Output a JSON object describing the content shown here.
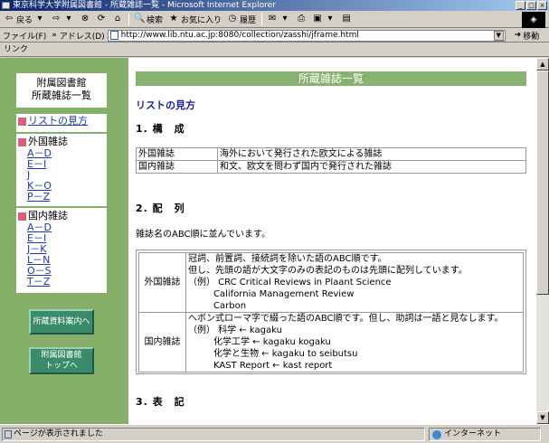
{
  "window": {
    "title": "東京科学大学附属図書館 - 所蔵雑誌一覧 - Microsoft Internet Explorer",
    "buttons": [
      "_",
      "□",
      "×"
    ]
  },
  "toolbar": {
    "back": "戻る",
    "search": "検索",
    "favorites": "お気に入り",
    "history": "履歴"
  },
  "address": {
    "menu_file": "ファイル(F)",
    "chevron": "»",
    "label": "アドレス(D)",
    "url": "http://www.lib.ntu.ac.jp:8080/collection/zasshi/jframe.html",
    "go": "移動"
  },
  "linkbar": {
    "label": "リンク"
  },
  "sidebar": {
    "library_title_line1": "附属図書館",
    "library_title_line2": "所蔵雑誌一覧",
    "guide_link": "リストの見方",
    "foreign": {
      "heading": "外国雑誌",
      "links": [
        "A－D",
        "E－I",
        "J",
        "K－O",
        "P－Z"
      ]
    },
    "domestic": {
      "heading": "国内雑誌",
      "links": [
        "A－D",
        "E－I",
        "J－K",
        "L－N",
        "O－S",
        "T－Z"
      ]
    },
    "button_guide": "所蔵資料案内へ",
    "button_top_line1": "附属図書館",
    "button_top_line2": "トップへ"
  },
  "main": {
    "banner": "所蔵雑誌一覧",
    "subtitle": "リストの見方",
    "sec1_title": "1. 構　成",
    "composition": [
      {
        "type": "外国雑誌",
        "desc": "海外において発行された欧文による雑誌"
      },
      {
        "type": "国内雑誌",
        "desc": "和文、欧文を問わず国内で発行された雑誌"
      }
    ],
    "sec2_title": "2. 配　列",
    "sec2_intro": "雑誌名のABC順に並んでいます。",
    "arr_foreign_label": "外国雑誌",
    "arr_foreign_line1": "冠詞、前置詞、接続詞を除いた語のABC順です。",
    "arr_foreign_line2": "但し、先頭の語が大文字のみの表記のものは先頭に配列しています。",
    "arr_foreign_ex1": "（例）  CRC Critical Reviews in Plaant Science",
    "arr_foreign_ex2": "California Management Review",
    "arr_foreign_ex3": "Carbon",
    "arr_domestic_label": "国内雑誌",
    "arr_domestic_line1": "ヘボン式ローマ字で綴った語のABC順です。但し、助詞は一語と見なします。",
    "arr_domestic_ex1": "（例）  科学  ←  kagaku",
    "arr_domestic_ex2": "化学工学  ←  kagaku kogaku",
    "arr_domestic_ex3": "化学と生物  ←  kagaku to seibutsu",
    "arr_domestic_ex4": "KAST Report  ←  kast report",
    "sec3_title": "3. 表　記"
  },
  "status": {
    "left": "ページが表示されました",
    "right": "インターネット"
  }
}
